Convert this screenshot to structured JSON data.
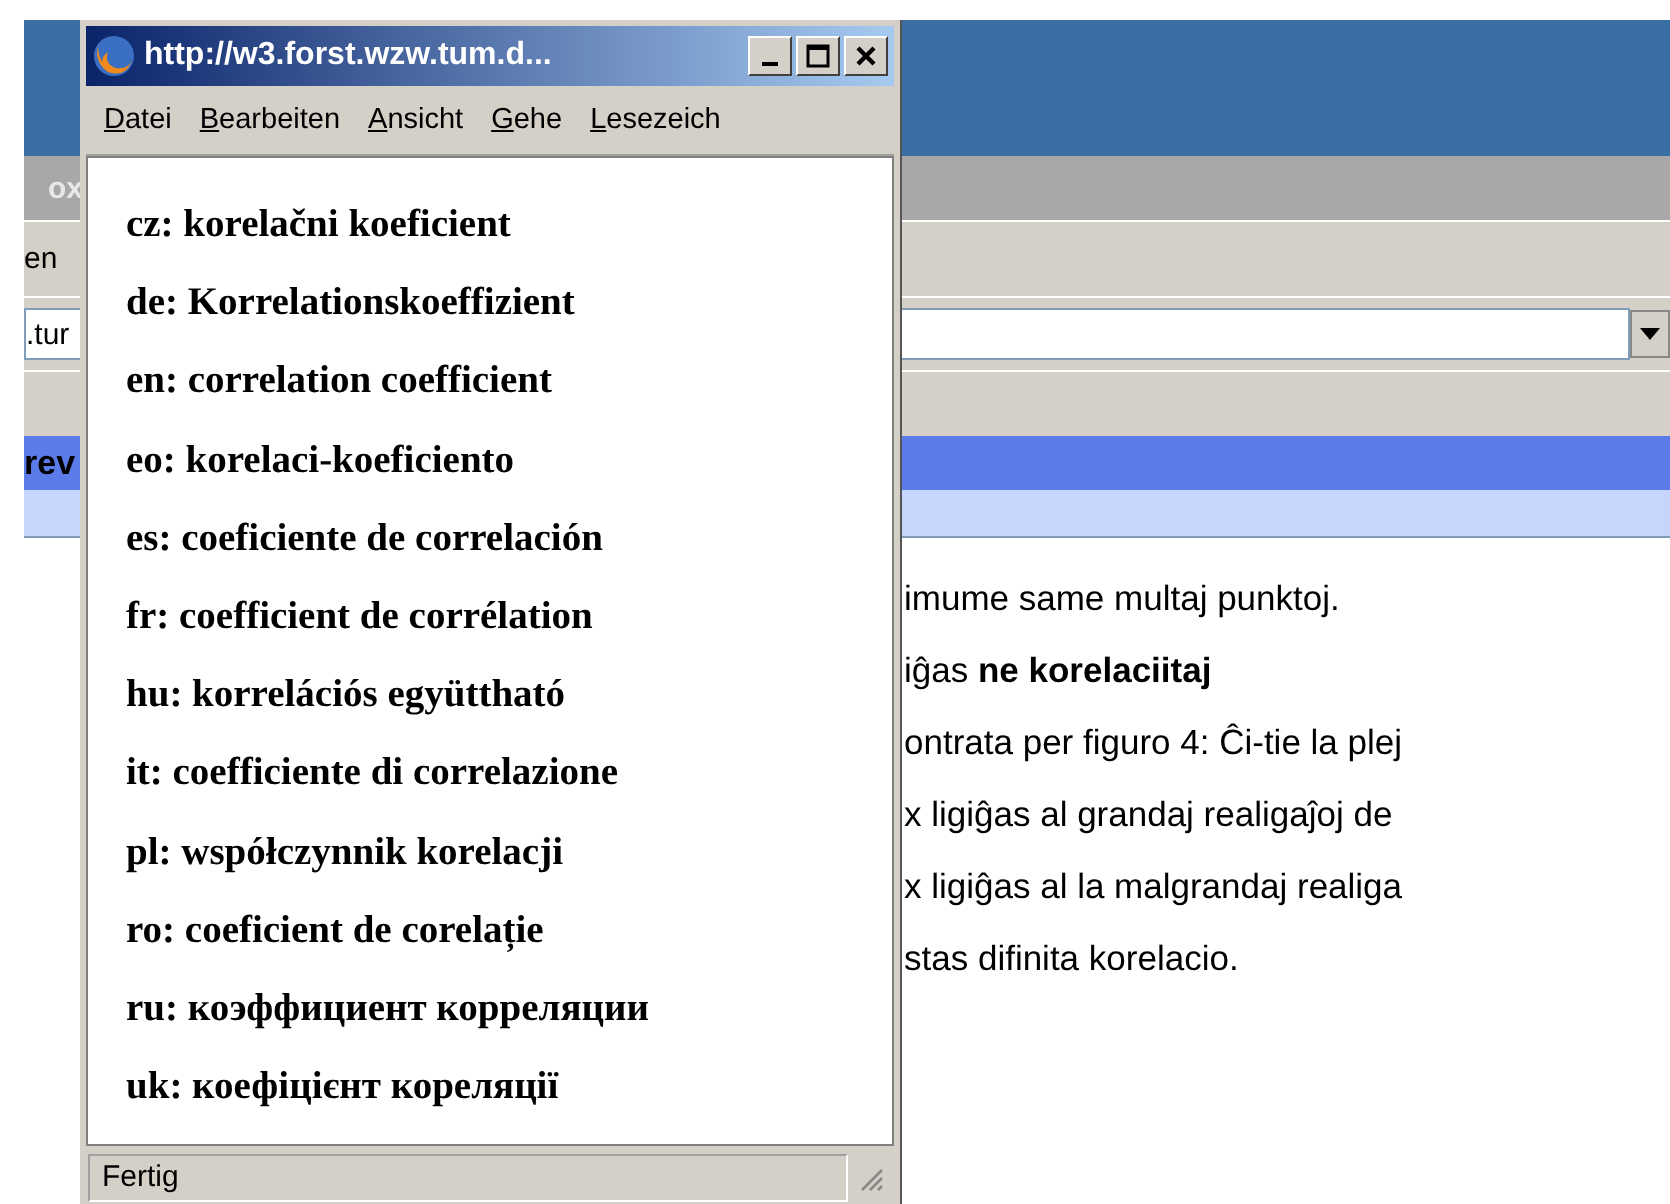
{
  "background_window": {
    "title": "ox",
    "menu_label": "en",
    "address": ".tur",
    "tab_label": "rev",
    "content": [
      {
        "text": "imume same multaj punktoj."
      },
      {
        "text": "iĝas **ne korelaciitaj**"
      },
      {
        "text": "ontrata per figuro 4: Ĉi-tie la plej"
      },
      {
        "text": "x ligiĝas al grandaj realigaĵoj de"
      },
      {
        "text": "x ligiĝas al la malgrandaj realiga"
      },
      {
        "text": "stas difinita korelacio."
      }
    ]
  },
  "popup": {
    "title": "http://w3.forst.wzw.tum.d...",
    "menu": [
      {
        "label": "Datei"
      },
      {
        "label": "Bearbeiten"
      },
      {
        "label": "Ansicht"
      },
      {
        "label": "Gehe"
      },
      {
        "label": "Lesezeich"
      }
    ],
    "terms": [
      {
        "text": "cz: korelačni koeficient"
      },
      {
        "text": "de: Korrelationskoeffizient"
      },
      {
        "text": "en: correlation coefficient"
      },
      {
        "text": "eo: korelaci-koeficiento"
      },
      {
        "text": "es: coeficiente de correlación"
      },
      {
        "text": "fr: coefficient de corrélation"
      },
      {
        "text": "hu: korrelációs együttható"
      },
      {
        "text": "it: coefficiente di correlazione"
      },
      {
        "text": "pl: współczynnik korelacji"
      },
      {
        "text": "ro: coeficient de corelație"
      },
      {
        "text": "ru: коэффициент корреляции"
      },
      {
        "text": "uk: коефіцієнт кореляції"
      }
    ],
    "status": "Fertig"
  }
}
